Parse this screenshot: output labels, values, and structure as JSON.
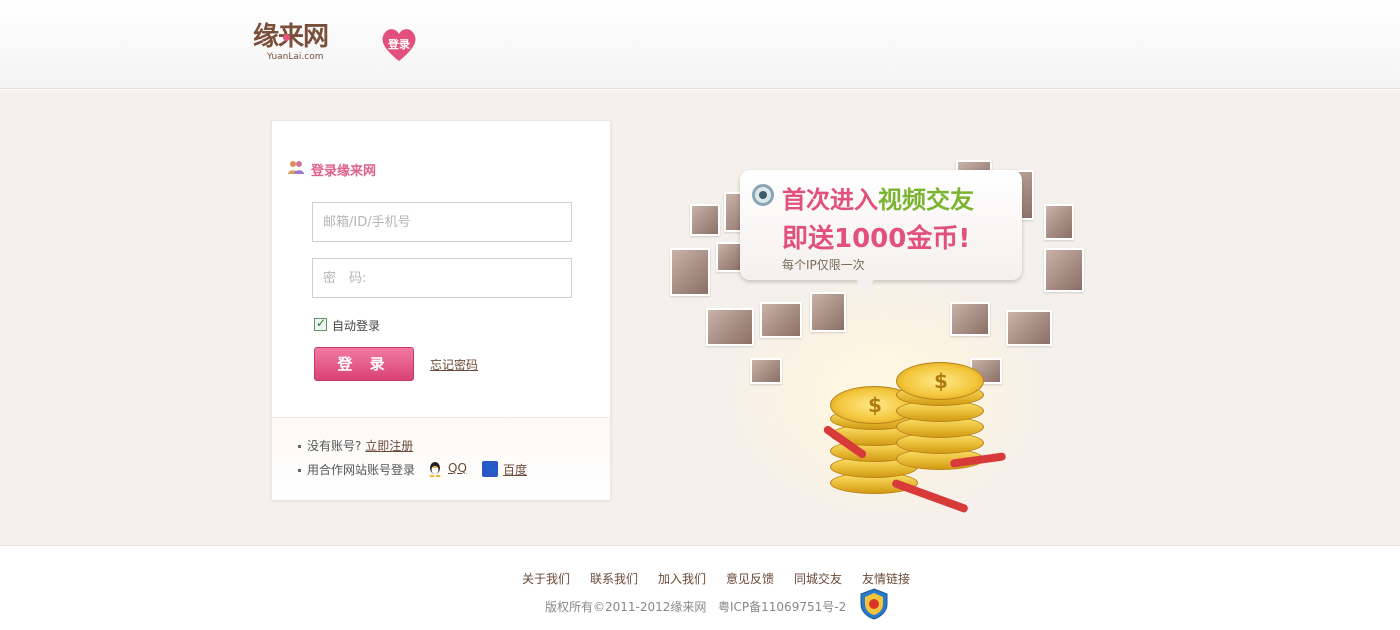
{
  "header": {
    "logo_text": "缘来网",
    "logo_sub": "YuanLai.com",
    "badge_label": "登录",
    "colors": {
      "brand_pink": "#e2507d",
      "logo_brown": "#7a4f3a"
    }
  },
  "login": {
    "title": "登录缘来网",
    "title_icon": "users-icon",
    "username_placeholder": "邮箱/ID/手机号",
    "password_placeholder": "密　码:",
    "auto_login_label": "自动登录",
    "auto_login_checked": true,
    "login_button": "登 录",
    "forgot_password": "忘记密码",
    "no_account_text": "没有账号?",
    "register_link": "立即注册",
    "partner_text": "用合作网站账号登录",
    "partners": [
      {
        "name": "QQ",
        "icon": "qq-penguin-icon"
      },
      {
        "name": "百度",
        "icon": "baidu-paw-icon"
      }
    ]
  },
  "promo": {
    "line1_part1": "首次进入",
    "line1_part2": "视频交友",
    "line2": "即送1000金币!",
    "line3": "每个IP仅限一次",
    "coin_symbol": "$"
  },
  "footer": {
    "links": [
      "关于我们",
      "联系我们",
      "加入我们",
      "意见反馈",
      "同城交友",
      "友情链接"
    ],
    "copyright": "版权所有©2011-2012缘来网",
    "icp": "粤ICP备11069751号-2",
    "badge_icon": "security-shield-icon"
  }
}
